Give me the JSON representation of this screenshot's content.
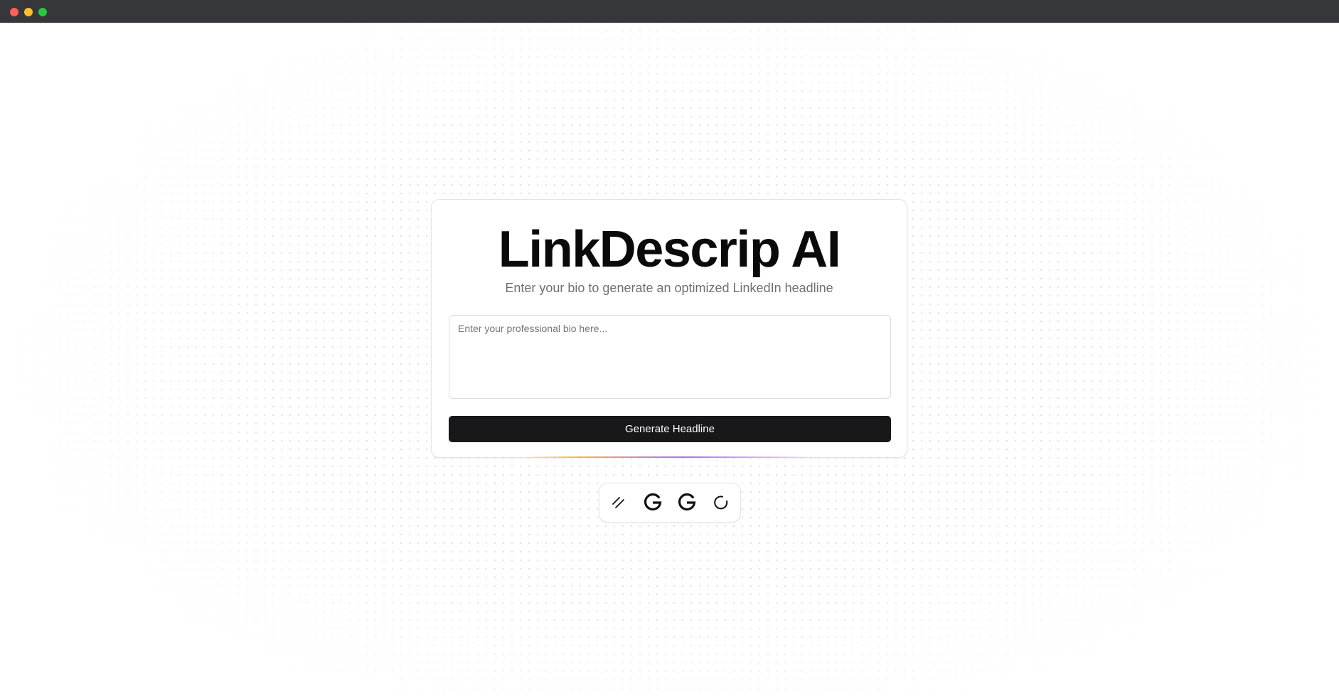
{
  "window": {
    "controls": [
      "close",
      "minimize",
      "maximize"
    ]
  },
  "hero": {
    "title": "LinkDescrip AI",
    "subtitle": "Enter your bio to generate an optimized LinkedIn headline"
  },
  "bio_input": {
    "value": "",
    "placeholder": "Enter your professional bio here..."
  },
  "generate_button": {
    "label": "Generate Headline"
  },
  "dock": {
    "icons": [
      "slash-lines-icon",
      "google-icon",
      "google-icon",
      "spinner-icon"
    ]
  },
  "colors": {
    "titlebar": "#36373a",
    "button": "#18181b",
    "accent_gradient_start": "#f59e0b",
    "accent_gradient_end": "#a855f7"
  }
}
